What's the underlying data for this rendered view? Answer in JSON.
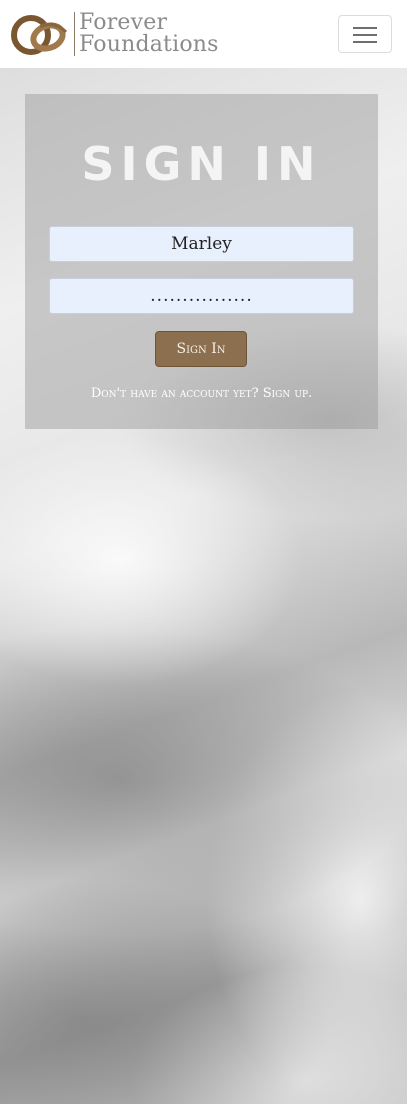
{
  "header": {
    "brand_line1": "Forever",
    "brand_line2": "Foundations",
    "logo_icon": "wedding-rings-icon",
    "menu_icon": "hamburger-menu-icon"
  },
  "signin": {
    "title": "SIGN IN",
    "username_value": "Marley",
    "password_value": "................",
    "button_label": "Sign In",
    "signup_prompt": "Don't have an account yet? Sign up."
  },
  "colors": {
    "brand_brown": "#8b6f4f",
    "brand_text_gray": "#8b8b8b",
    "input_fill": "#e8f0fe"
  }
}
